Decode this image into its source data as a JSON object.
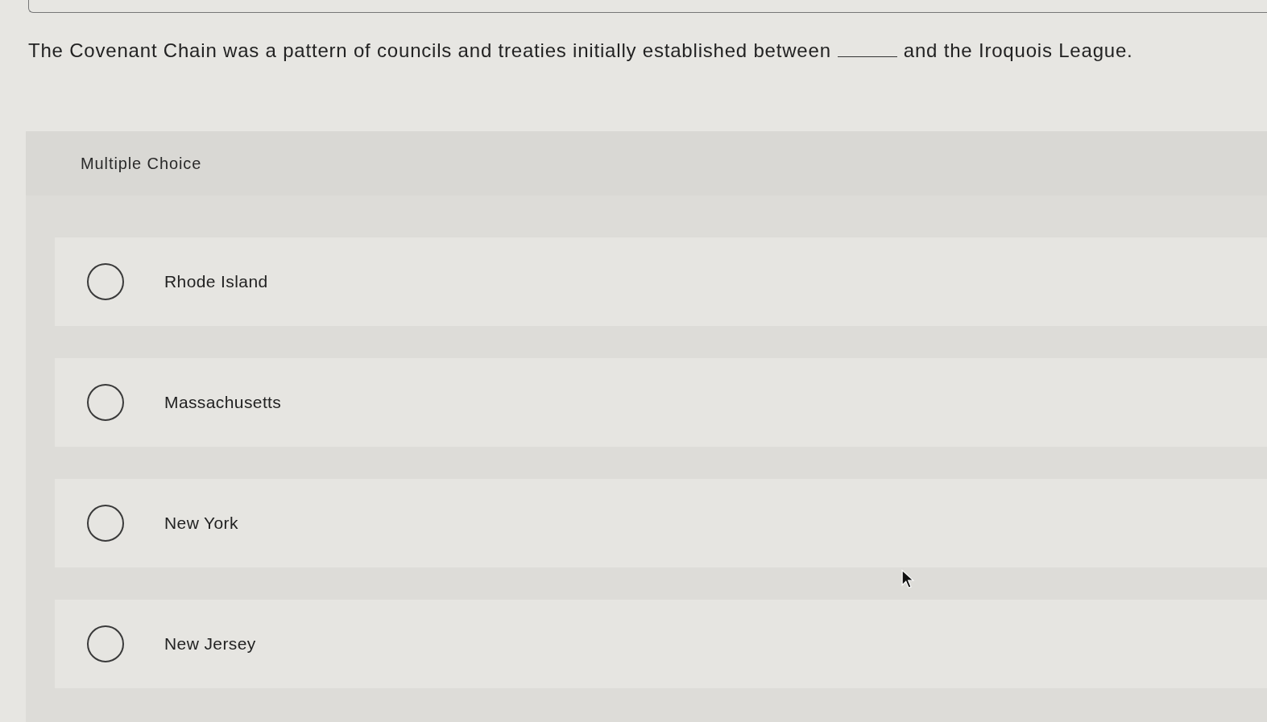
{
  "question": {
    "text_before": "The Covenant Chain was a pattern of councils and treaties initially established between",
    "text_after": "and the Iroquois League."
  },
  "panel": {
    "title": "Multiple Choice"
  },
  "options": [
    {
      "label": "Rhode Island",
      "selected": false
    },
    {
      "label": "Massachusetts",
      "selected": false
    },
    {
      "label": "New York",
      "selected": false
    },
    {
      "label": "New Jersey",
      "selected": false
    }
  ]
}
